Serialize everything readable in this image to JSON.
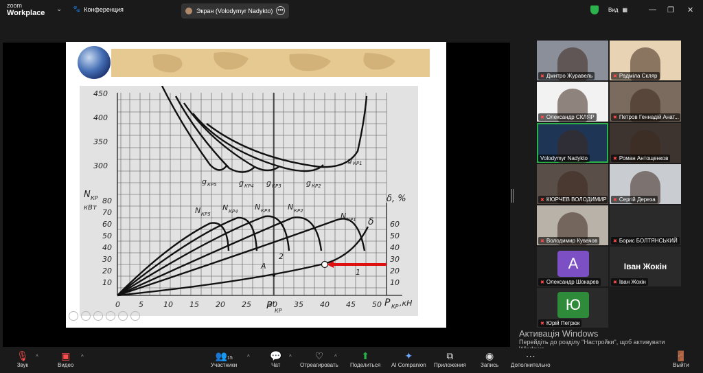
{
  "topbar": {
    "logo_small": "zoom",
    "logo_big": "Workplace",
    "conference_label": "Конференция",
    "share_label": "Экран (Volodymyr Nadykto)",
    "view_label": "Вид"
  },
  "slide": {
    "y_axis_top_ticks": [
      "450",
      "400",
      "350",
      "300"
    ],
    "y_axis_left_label": "N",
    "y_axis_left_sub": "КР",
    "y_axis_left_unit": "кВт",
    "y_axis_left_ticks": [
      "80",
      "70",
      "60",
      "50",
      "40",
      "30",
      "20",
      "10"
    ],
    "y_axis_right_label": "δ, %",
    "y_axis_right_ticks": [
      "60",
      "50",
      "40",
      "30",
      "20",
      "10"
    ],
    "x_ticks": [
      "0",
      "5",
      "10",
      "15",
      "20",
      "25",
      "30",
      "35",
      "40",
      "45",
      "50"
    ],
    "x_label": "P",
    "x_label_sub": "КР",
    "x_label_unit": ",кН",
    "p_prime_label": "P'",
    "p_prime_sub": "КР",
    "g_labels": [
      "g",
      "g",
      "g",
      "g",
      "g"
    ],
    "g_subs": [
      "КР5",
      "КР4",
      "КР3",
      "КР2",
      "КР1"
    ],
    "n_labels": [
      "N",
      "N",
      "N",
      "N",
      "N"
    ],
    "n_subs": [
      "КР5",
      "КР4",
      "КР3",
      "КР2",
      "КР1"
    ],
    "delta_label": "δ",
    "point_a_label": "A",
    "curve_2_label": "2",
    "curve_1_label": "1"
  },
  "participants": [
    {
      "name": "Дмитро Журавель",
      "mic_muted": true,
      "kind": "video",
      "color": "#8a8f99"
    },
    {
      "name": "Радміла Скляр",
      "mic_muted": true,
      "kind": "video",
      "color": "#e8d3b4"
    },
    {
      "name": "Олександр СКЛЯР",
      "mic_muted": true,
      "kind": "video",
      "color": "#f2f2f2"
    },
    {
      "name": "Петров Геннадій Анат...",
      "mic_muted": true,
      "kind": "video",
      "color": "#7b6a5e"
    },
    {
      "name": "Volodymyr Nadykto",
      "mic_muted": false,
      "kind": "video",
      "color": "#1f3556"
    },
    {
      "name": "Роман Антощенков",
      "mic_muted": true,
      "kind": "video",
      "color": "#3d3430"
    },
    {
      "name": "КЮРЧЕВ ВОЛОДИМИР",
      "mic_muted": true,
      "kind": "video",
      "color": "#5a4e48"
    },
    {
      "name": "Сергій Дереза",
      "mic_muted": true,
      "kind": "video",
      "color": "#c9cdd2"
    },
    {
      "name": "Володимир Кувачов",
      "mic_muted": true,
      "kind": "video",
      "color": "#b8b2a8"
    },
    {
      "name": "Борис БОЛТЯНСЬКИЙ",
      "mic_muted": true,
      "kind": "blank",
      "color": "#2a2a2a"
    },
    {
      "name": "Олександр Шокарев",
      "mic_muted": true,
      "kind": "avatar",
      "initial": "A",
      "color": "#7d4fc4"
    },
    {
      "name": "Іван Жокін",
      "mic_muted": true,
      "kind": "bigname",
      "color": "#2a2a2a"
    },
    {
      "name": "Юрій Петрюк",
      "mic_muted": true,
      "kind": "avatar",
      "initial": "Ю",
      "color": "#2e8b3a"
    }
  ],
  "watermark": {
    "title": "Активація Windows",
    "text": "Перейдіть до розділу \"Настройки\", щоб активувати Windows."
  },
  "toolbar": {
    "audio": "Звук",
    "video": "Видео",
    "participants": "Участники",
    "participants_count": "15",
    "chat": "Чат",
    "react": "Отреагировать",
    "share": "Поделиться",
    "ai": "AI Companion",
    "apps": "Приложения",
    "record": "Запись",
    "more": "Дополнительно",
    "leave": "Выйти"
  },
  "colors": {
    "accent_green": "#2bb24c",
    "muted_red": "#ff4d4d",
    "arrow_red": "#dd1111"
  }
}
